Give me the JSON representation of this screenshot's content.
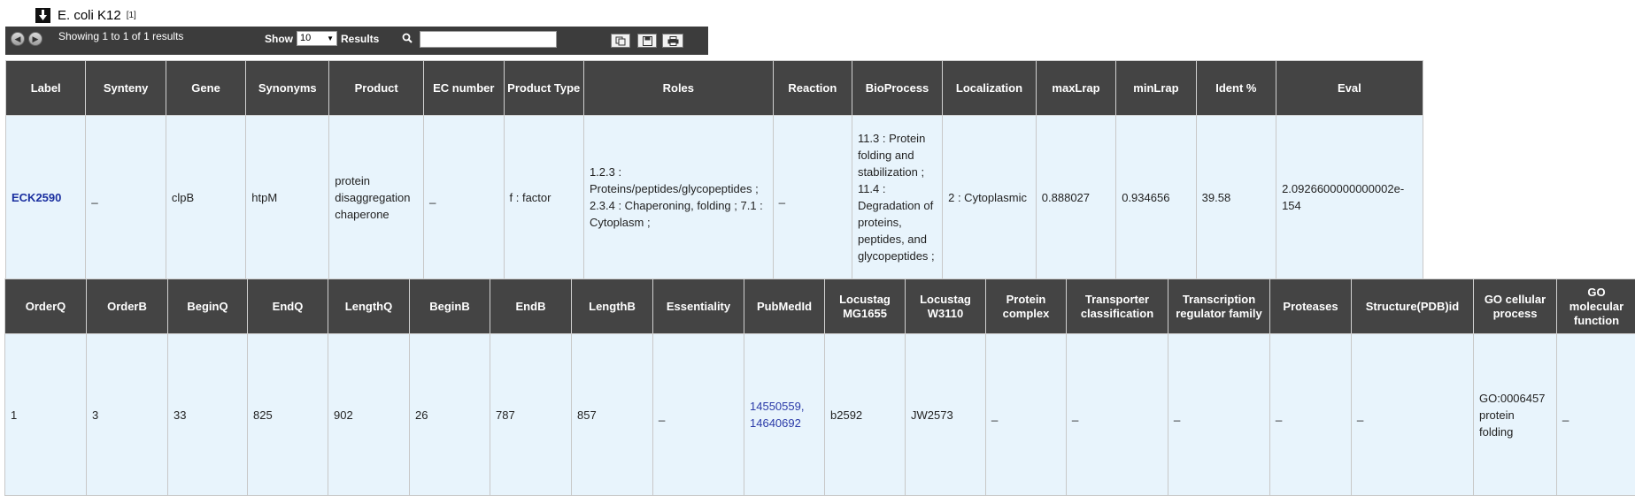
{
  "header": {
    "title": "E. coli K12",
    "ref": "[1]"
  },
  "toolbar": {
    "showing": "Showing 1 to 1 of 1 results",
    "show_label": "Show",
    "page_size": "10",
    "results_label": "Results",
    "search_value": ""
  },
  "table1": {
    "headers": [
      "Label",
      "Synteny",
      "Gene",
      "Synonyms",
      "Product",
      "EC number",
      "Product Type",
      "Roles",
      "Reaction",
      "BioProcess",
      "Localization",
      "maxLrap",
      "minLrap",
      "Ident %",
      "Eval"
    ],
    "row": {
      "label": "ECK2590",
      "synteny": "_",
      "gene": "clpB",
      "synonyms": "htpM",
      "product": "protein disaggregation chaperone",
      "ec_number": "_",
      "product_type": "f : factor",
      "roles": "1.2.3 : Proteins/peptides/glycopeptides ; 2.3.4 : Chaperoning, folding ; 7.1 : Cytoplasm ;",
      "reaction": "_",
      "bioprocess": "11.3 : Protein folding and stabilization ; 11.4 : Degradation of proteins, peptides, and glycopeptides ;",
      "localization": "2 : Cytoplasmic",
      "maxlrap": "0.888027",
      "minlrap": "0.934656",
      "ident": "39.58",
      "eval": "2.0926600000000002e-154"
    }
  },
  "table2": {
    "headers": [
      "OrderQ",
      "OrderB",
      "BeginQ",
      "EndQ",
      "LengthQ",
      "BeginB",
      "EndB",
      "LengthB",
      "Essentiality",
      "PubMedId",
      "Locustag MG1655",
      "Locustag W3110",
      "Protein complex",
      "Transporter classification",
      "Transcription regulator family",
      "Proteases",
      "Structure(PDB)id",
      "GO cellular process",
      "GO molecular function"
    ],
    "row": {
      "orderq": "1",
      "orderb": "3",
      "beginq": "33",
      "endq": "825",
      "lengthq": "902",
      "beginb": "26",
      "endb": "787",
      "lengthb": "857",
      "essentiality": "_",
      "pubmed": "14550559, 14640692",
      "locustag_mg1655": "b2592",
      "locustag_w3110": "JW2573",
      "protein_complex": "_",
      "transporter": "_",
      "transcription_family": "_",
      "proteases": "_",
      "structure": "_",
      "go_cellular": "GO:0006457 protein folding",
      "go_molecular": "_"
    }
  },
  "icons": [
    "arrow-down-icon",
    "prev-page-icon",
    "next-page-icon",
    "search-icon",
    "copy-icon",
    "save-icon",
    "print-icon"
  ],
  "colors": {
    "header_bg": "#444444",
    "cell_bg": "#e8f4fc",
    "link": "#1a2fa0"
  }
}
